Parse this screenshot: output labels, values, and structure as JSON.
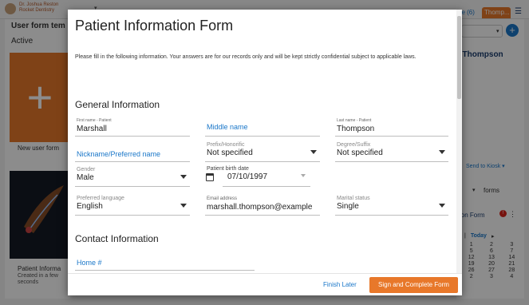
{
  "background": {
    "user_name": "Dr. Joshua Reston",
    "practice_name": "Rocket Dentistry",
    "left_title": "User form tem",
    "active_label": "Active",
    "new_form_label": "New user form",
    "patient_form_label": "Patient Informa",
    "created_label": "Created in a few seconds",
    "queue_tab_label": "ue (6)",
    "patient_tab_label": "Thomp...",
    "patient_name": "l Thompson",
    "send_to_kiosk": "Send to Kiosk",
    "forms_label": "forms",
    "from_label": "ion Form",
    "alert_count": "!",
    "calendar": {
      "today_label": "Today",
      "rows": [
        [
          "1",
          "2",
          "3"
        ],
        [
          "5",
          "6",
          "7"
        ],
        [
          "12",
          "13",
          "14"
        ],
        [
          "19",
          "20",
          "21"
        ],
        [
          "26",
          "27",
          "28"
        ],
        [
          "2",
          "3",
          "4"
        ]
      ]
    }
  },
  "modal": {
    "title": "Patient Information Form",
    "intro": "Please fill in the following information. Your answers are for our records only and will be kept strictly confidential subject to applicable laws.",
    "general_title": "General Information",
    "contact_title": "Contact Information",
    "fields": {
      "first_name": {
        "label": "First name - Patient",
        "value": "Marshall"
      },
      "middle_name": {
        "placeholder": "Middle name"
      },
      "last_name": {
        "label": "Last name - Patient",
        "value": "Thompson"
      },
      "nickname": {
        "placeholder": "Nickname/Preferred name"
      },
      "prefix": {
        "label": "Prefix/Honorific",
        "value": "Not specified"
      },
      "degree": {
        "label": "Degree/Suffix",
        "value": "Not specified"
      },
      "gender": {
        "label": "Gender",
        "value": "Male"
      },
      "birth_date": {
        "label": "Patient birth date",
        "value": "07/10/1997"
      },
      "language": {
        "label": "Preferred language",
        "value": "English"
      },
      "email": {
        "label": "Email address",
        "value": "marshall.thompson@example"
      },
      "marital": {
        "label": "Marital status",
        "value": "Single"
      },
      "home_phone": {
        "placeholder": "Home #"
      }
    },
    "footer": {
      "finish_later": "Finish Later",
      "sign_complete": "Sign and Complete Form"
    }
  },
  "colors": {
    "accent_orange": "#e8782a",
    "link_blue": "#1a77c9",
    "navy": "#1a3c6e"
  }
}
